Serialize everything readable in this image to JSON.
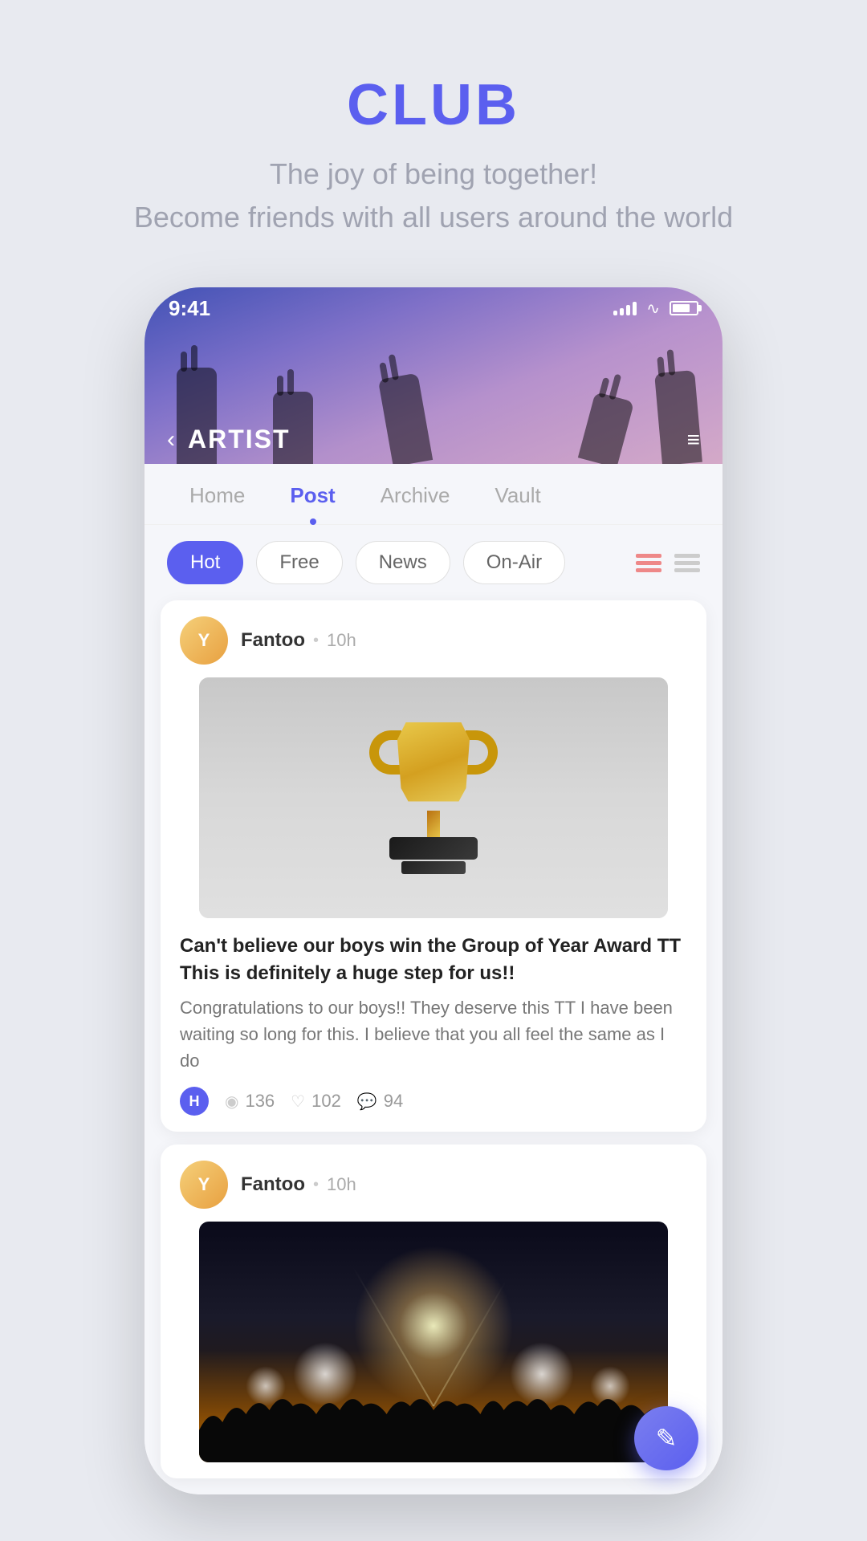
{
  "page": {
    "title": "CLUB",
    "subtitle_line1": "The joy of being together!",
    "subtitle_line2": "Become friends with all users around the world"
  },
  "status_bar": {
    "time": "9:41",
    "signal_alt": "signal bars",
    "wifi_alt": "wifi",
    "battery_alt": "battery"
  },
  "nav": {
    "back_label": "‹",
    "title": "ARTIST",
    "menu_label": "≡"
  },
  "tabs": [
    {
      "label": "Home",
      "active": false
    },
    {
      "label": "Post",
      "active": true
    },
    {
      "label": "Archive",
      "active": false
    },
    {
      "label": "Vault",
      "active": false
    }
  ],
  "filters": [
    {
      "label": "Hot",
      "active": true
    },
    {
      "label": "Free",
      "active": false
    },
    {
      "label": "News",
      "active": false
    },
    {
      "label": "On-Air",
      "active": false
    }
  ],
  "posts": [
    {
      "avatar_letter": "Y",
      "author": "Fantoo",
      "time": "10h",
      "image_type": "trophy",
      "title": "Can't believe our boys win the Group of Year Award TT This is definitely a huge step for us!!",
      "body": "Congratulations to our boys!! They deserve this TT I have been waiting so long for this. I believe that you all feel the same as I do",
      "badge": "H",
      "views": "136",
      "likes": "102",
      "comments": "94"
    },
    {
      "avatar_letter": "Y",
      "author": "Fantoo",
      "time": "10h",
      "image_type": "concert",
      "title": "",
      "body": "",
      "badge": "",
      "views": "",
      "likes": "",
      "comments": ""
    }
  ],
  "fab": {
    "label": "✎"
  }
}
